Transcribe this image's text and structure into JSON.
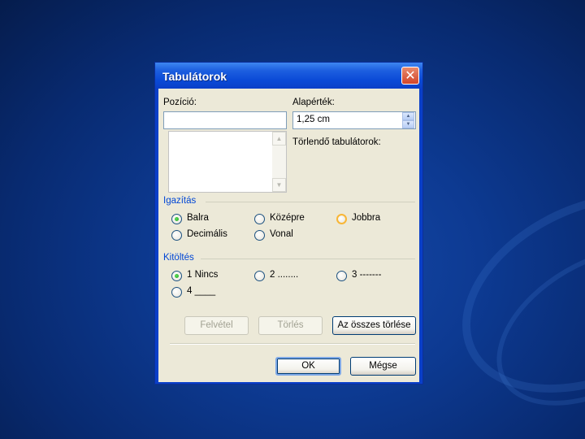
{
  "dialog": {
    "title": "Tabulátorok",
    "close_glyph": "✕",
    "position": {
      "label": "Pozíció:",
      "value": ""
    },
    "default_stop": {
      "label": "Alapérték:",
      "value": "1,25 cm"
    },
    "clear_label": "Törlendő tabulátorok:",
    "alignment": {
      "title": "Igazítás",
      "options": [
        {
          "label": "Balra",
          "checked": true
        },
        {
          "label": "Középre",
          "checked": false
        },
        {
          "label": "Jobbra",
          "checked": false
        },
        {
          "label": "Decimális",
          "checked": false
        },
        {
          "label": "Vonal",
          "checked": false
        }
      ]
    },
    "leader": {
      "title": "Kitöltés",
      "options": [
        {
          "label": "1 Nincs",
          "checked": true
        },
        {
          "label": "2 ........",
          "checked": false
        },
        {
          "label": "3 -------",
          "checked": false
        },
        {
          "label": "4 ____",
          "checked": false
        }
      ]
    },
    "buttons": {
      "set": "Felvétel",
      "clear": "Törlés",
      "clear_all": "Az összes törlése",
      "ok": "OK",
      "cancel": "Mégse"
    },
    "icons": {
      "close": "close-icon",
      "scroll_up": "scroll-up-arrow-icon",
      "scroll_down": "scroll-down-arrow-icon",
      "spin_up": "spin-up-arrow-icon",
      "spin_down": "spin-down-arrow-icon"
    },
    "colors": {
      "titlebar": "#0a49d6",
      "client": "#ece9d8",
      "group_title": "#0046d5",
      "close_button": "#d2452a",
      "radio_checked": "#21a121"
    }
  }
}
